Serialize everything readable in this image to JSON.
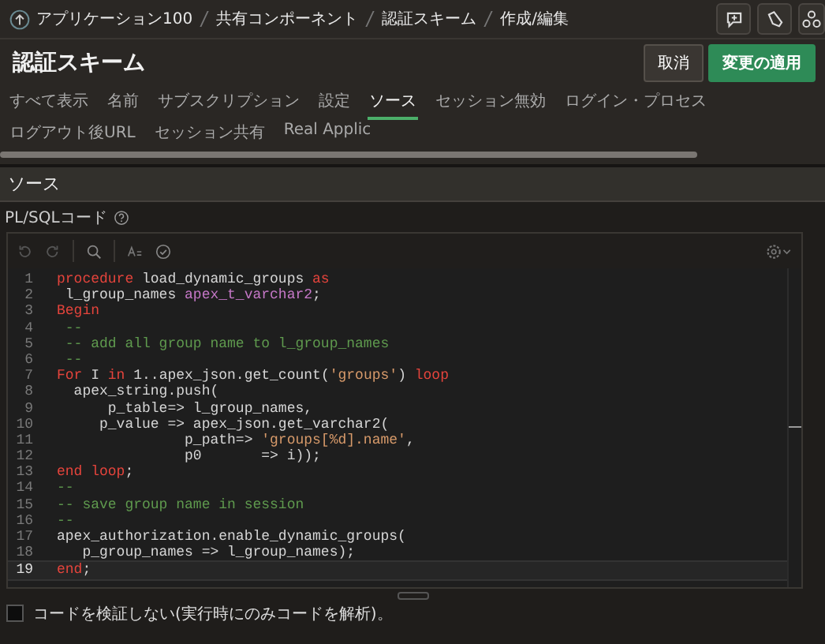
{
  "breadcrumb": [
    {
      "label": "アプリケーション100"
    },
    {
      "label": "共有コンポーネント"
    },
    {
      "label": "認証スキーム"
    },
    {
      "label": "作成/編集"
    }
  ],
  "page_title": "認証スキーム",
  "buttons": [
    {
      "label": "取消",
      "kind": "secondary"
    },
    {
      "label": "変更の適用",
      "kind": "primary"
    }
  ],
  "tabs": [
    {
      "label": "すべて表示",
      "selected": false
    },
    {
      "label": "名前",
      "selected": false
    },
    {
      "label": "サブスクリプション",
      "selected": false
    },
    {
      "label": "設定",
      "selected": false
    },
    {
      "label": "ソース",
      "selected": true
    },
    {
      "label": "セッション無効",
      "selected": false
    },
    {
      "label": "ログイン・プロセス",
      "selected": false
    },
    {
      "label": "ログアウト後URL",
      "selected": false
    },
    {
      "label": "セッション共有",
      "selected": false
    },
    {
      "label": "Real Applic",
      "selected": false
    }
  ],
  "section_title": "ソース",
  "field_label": "PL/SQLコード",
  "code_lines": [
    {
      "number": "1",
      "current": false,
      "tokens": [
        {
          "kind": "keyword",
          "text": "procedure"
        },
        {
          "kind": "plain",
          "text": " load_dynamic_groups "
        },
        {
          "kind": "keyword",
          "text": "as"
        }
      ]
    },
    {
      "number": "2",
      "current": false,
      "tokens": [
        {
          "kind": "plain",
          "text": " l_group_names "
        },
        {
          "kind": "type",
          "text": "apex_t_varchar2"
        },
        {
          "kind": "plain",
          "text": ";"
        }
      ]
    },
    {
      "number": "3",
      "current": false,
      "tokens": [
        {
          "kind": "keyword",
          "text": "Begin"
        }
      ]
    },
    {
      "number": "4",
      "current": false,
      "tokens": [
        {
          "kind": "comment",
          "text": " --"
        }
      ]
    },
    {
      "number": "5",
      "current": false,
      "tokens": [
        {
          "kind": "comment",
          "text": " -- add all group name to l_group_names"
        }
      ]
    },
    {
      "number": "6",
      "current": false,
      "tokens": [
        {
          "kind": "comment",
          "text": " --"
        }
      ]
    },
    {
      "number": "7",
      "current": false,
      "tokens": [
        {
          "kind": "keyword",
          "text": "For"
        },
        {
          "kind": "plain",
          "text": " I "
        },
        {
          "kind": "keyword",
          "text": "in"
        },
        {
          "kind": "plain",
          "text": " 1..apex_json.get_count("
        },
        {
          "kind": "string",
          "text": "'groups'"
        },
        {
          "kind": "plain",
          "text": ") "
        },
        {
          "kind": "keyword",
          "text": "loop"
        }
      ]
    },
    {
      "number": "8",
      "current": false,
      "tokens": [
        {
          "kind": "plain",
          "text": "  apex_string.push("
        }
      ]
    },
    {
      "number": "9",
      "current": false,
      "tokens": [
        {
          "kind": "plain",
          "text": "      p_table=> l_group_names,"
        }
      ]
    },
    {
      "number": "10",
      "current": false,
      "tokens": [
        {
          "kind": "plain",
          "text": "     p_value => apex_json.get_varchar2("
        }
      ]
    },
    {
      "number": "11",
      "current": false,
      "tokens": [
        {
          "kind": "plain",
          "text": "               p_path=> "
        },
        {
          "kind": "string",
          "text": "'groups[%d].name'"
        },
        {
          "kind": "plain",
          "text": ","
        }
      ]
    },
    {
      "number": "12",
      "current": false,
      "tokens": [
        {
          "kind": "plain",
          "text": "               p0       => i));"
        }
      ]
    },
    {
      "number": "13",
      "current": false,
      "tokens": [
        {
          "kind": "keyword",
          "text": "end loop"
        },
        {
          "kind": "plain",
          "text": ";"
        }
      ]
    },
    {
      "number": "14",
      "current": false,
      "tokens": [
        {
          "kind": "comment",
          "text": "--"
        }
      ]
    },
    {
      "number": "15",
      "current": false,
      "tokens": [
        {
          "kind": "comment",
          "text": "-- save group name in session"
        }
      ]
    },
    {
      "number": "16",
      "current": false,
      "tokens": [
        {
          "kind": "comment",
          "text": "--"
        }
      ]
    },
    {
      "number": "17",
      "current": false,
      "tokens": [
        {
          "kind": "plain",
          "text": "apex_authorization.enable_dynamic_groups("
        }
      ]
    },
    {
      "number": "18",
      "current": false,
      "tokens": [
        {
          "kind": "plain",
          "text": "   p_group_names => l_group_names);"
        }
      ]
    },
    {
      "number": "19",
      "current": true,
      "tokens": [
        {
          "kind": "keyword",
          "text": "end"
        },
        {
          "kind": "plain",
          "text": ";"
        }
      ]
    }
  ],
  "checkbox": {
    "label": "コードを検証しない(実行時にのみコードを解析)。",
    "checked": false
  }
}
